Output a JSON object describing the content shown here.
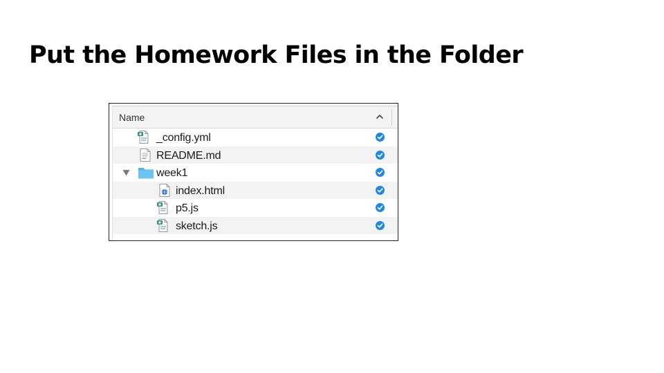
{
  "slide": {
    "title": "Put the Homework Files in the Folder"
  },
  "finder": {
    "column_header": "Name",
    "sort_icon": "chevron-up-icon",
    "status_icon": "synced-checkmark-icon",
    "accent_color": "#1e88e5",
    "folder_color": "#4fb4ea",
    "items": [
      {
        "name": "_config.yml",
        "icon": "script-document-icon",
        "depth": 0,
        "expanded": false
      },
      {
        "name": "README.md",
        "icon": "text-document-icon",
        "depth": 0,
        "expanded": false
      },
      {
        "name": "week1",
        "icon": "folder-icon",
        "depth": 0,
        "expanded": true
      },
      {
        "name": "index.html",
        "icon": "html-document-icon",
        "depth": 1,
        "expanded": false
      },
      {
        "name": "p5.js",
        "icon": "script-document-icon",
        "depth": 1,
        "expanded": false
      },
      {
        "name": "sketch.js",
        "icon": "script-document-icon",
        "depth": 1,
        "expanded": false
      }
    ]
  }
}
